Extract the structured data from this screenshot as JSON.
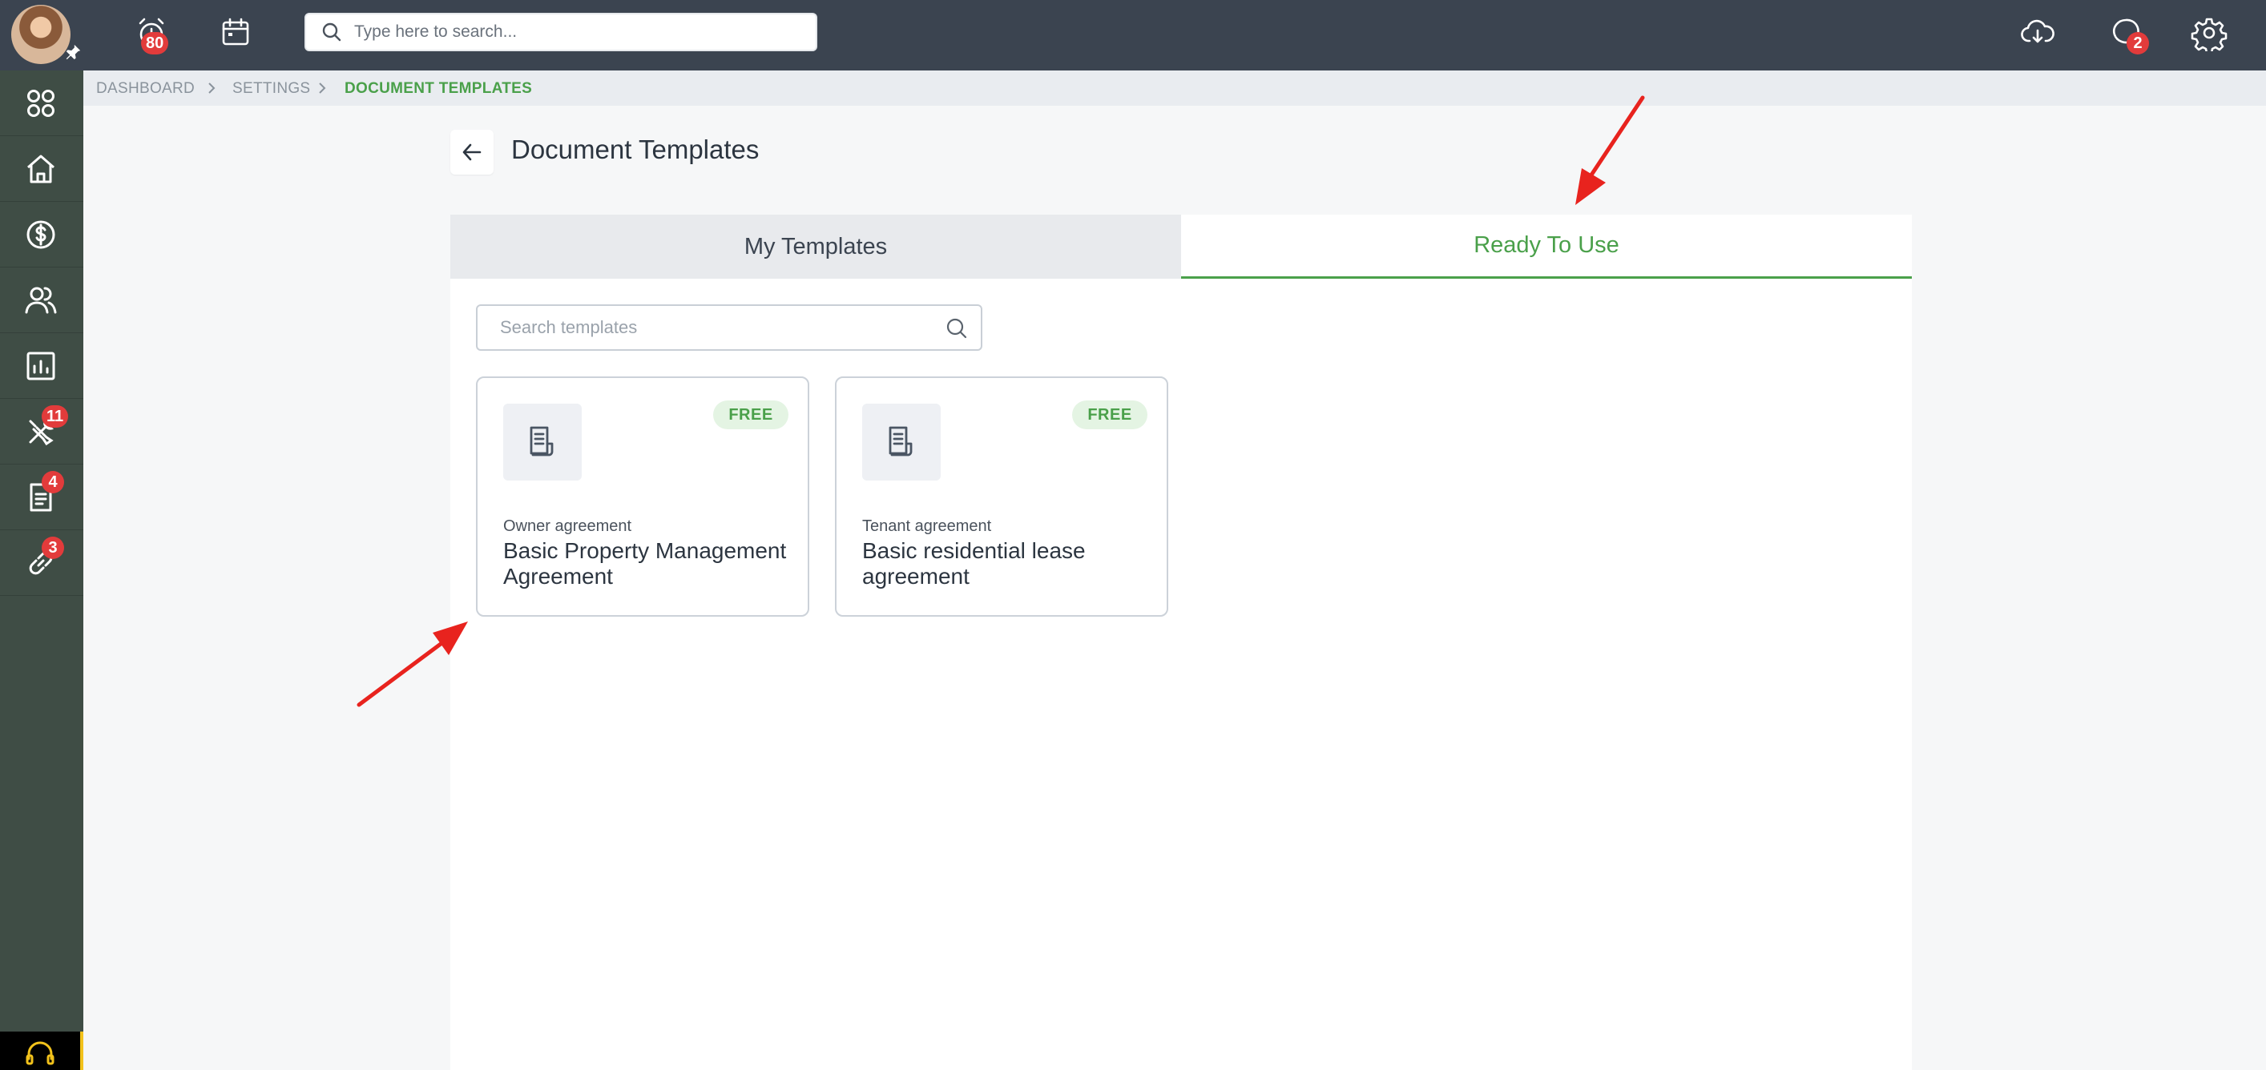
{
  "topbar": {
    "alarm_badge": "80",
    "search_placeholder": "Type here to search...",
    "chat_badge": "2"
  },
  "sidebar": {
    "items": [
      {
        "icon": "apps-grid-icon",
        "badge": ""
      },
      {
        "icon": "home-icon",
        "badge": ""
      },
      {
        "icon": "dollar-icon",
        "badge": ""
      },
      {
        "icon": "users-icon",
        "badge": ""
      },
      {
        "icon": "chart-icon",
        "badge": ""
      },
      {
        "icon": "tools-icon",
        "badge": "11"
      },
      {
        "icon": "document-icon",
        "badge": "4"
      },
      {
        "icon": "link-icon",
        "badge": "3"
      }
    ]
  },
  "breadcrumb": {
    "items": [
      "DASHBOARD",
      "SETTINGS",
      "DOCUMENT TEMPLATES"
    ]
  },
  "page": {
    "title": "Document Templates"
  },
  "tabs": [
    {
      "label": "My Templates",
      "active": false
    },
    {
      "label": "Ready To Use",
      "active": true
    }
  ],
  "template_search": {
    "placeholder": "Search templates"
  },
  "templates": [
    {
      "badge": "FREE",
      "category": "Owner agreement",
      "name": "Basic Property Management Agreement"
    },
    {
      "badge": "FREE",
      "category": "Tenant agreement",
      "name": "Basic residential lease agreement"
    }
  ],
  "colors": {
    "topbar": "#3b4450",
    "sidebar": "#3f4d45",
    "accent_green": "#4aa04a",
    "badge_red": "#e23b3b",
    "annotation_red": "#e8231e"
  }
}
